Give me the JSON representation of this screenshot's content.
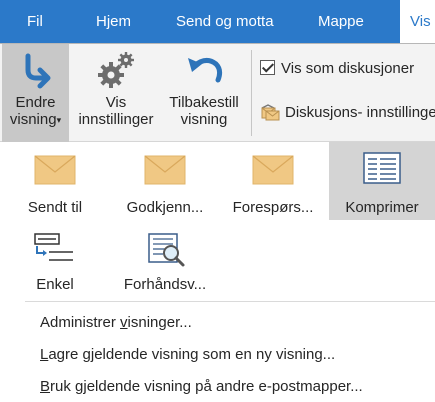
{
  "tabs": [
    {
      "label": "Fil"
    },
    {
      "label": "Hjem"
    },
    {
      "label": "Send og motta"
    },
    {
      "label": "Mappe"
    },
    {
      "label": "Vis"
    }
  ],
  "ribbon": {
    "change_view": {
      "line1": "Endre",
      "line2": "visning",
      "caret": "▾",
      "icon": "change-view-arrow-icon"
    },
    "view_settings": {
      "line1": "Vis",
      "line2": "innstillinger",
      "icon": "gears-icon"
    },
    "reset_view": {
      "line1": "Tilbakestill",
      "line2": "visning",
      "icon": "undo-arrow-icon"
    },
    "show_as_conversations": {
      "label": "Vis som diskusjoner",
      "checked": true
    },
    "conversation_settings": {
      "label": "Diskusjons- innstillinger",
      "icon": "conversation-settings-icon"
    }
  },
  "gallery": {
    "row1": [
      {
        "label": "Sendt til",
        "icon": "envelope-icon"
      },
      {
        "label": "Godkjenn...",
        "icon": "envelope-icon"
      },
      {
        "label": "Forespørs...",
        "icon": "envelope-icon"
      },
      {
        "label": "Komprimer",
        "icon": "compact-list-icon",
        "selected": true
      }
    ],
    "row2": [
      {
        "label": "Enkel",
        "icon": "single-list-icon"
      },
      {
        "label": "Forhåndsv...",
        "icon": "preview-icon"
      }
    ]
  },
  "menu": {
    "manage_views": {
      "pre": "Administrer ",
      "hot": "v",
      "post": "isninger..."
    },
    "save_view": {
      "pre": "",
      "hot": "L",
      "post": "agre gjeldende visning som en ny visning..."
    },
    "apply_view": {
      "pre": "",
      "hot": "B",
      "post": "ruk gjeldende visning på andre e-postmapper..."
    }
  },
  "colors": {
    "accent": "#2b79c9",
    "envelope": "#f0c884",
    "ribbon_bg": "#f3f3f3"
  }
}
